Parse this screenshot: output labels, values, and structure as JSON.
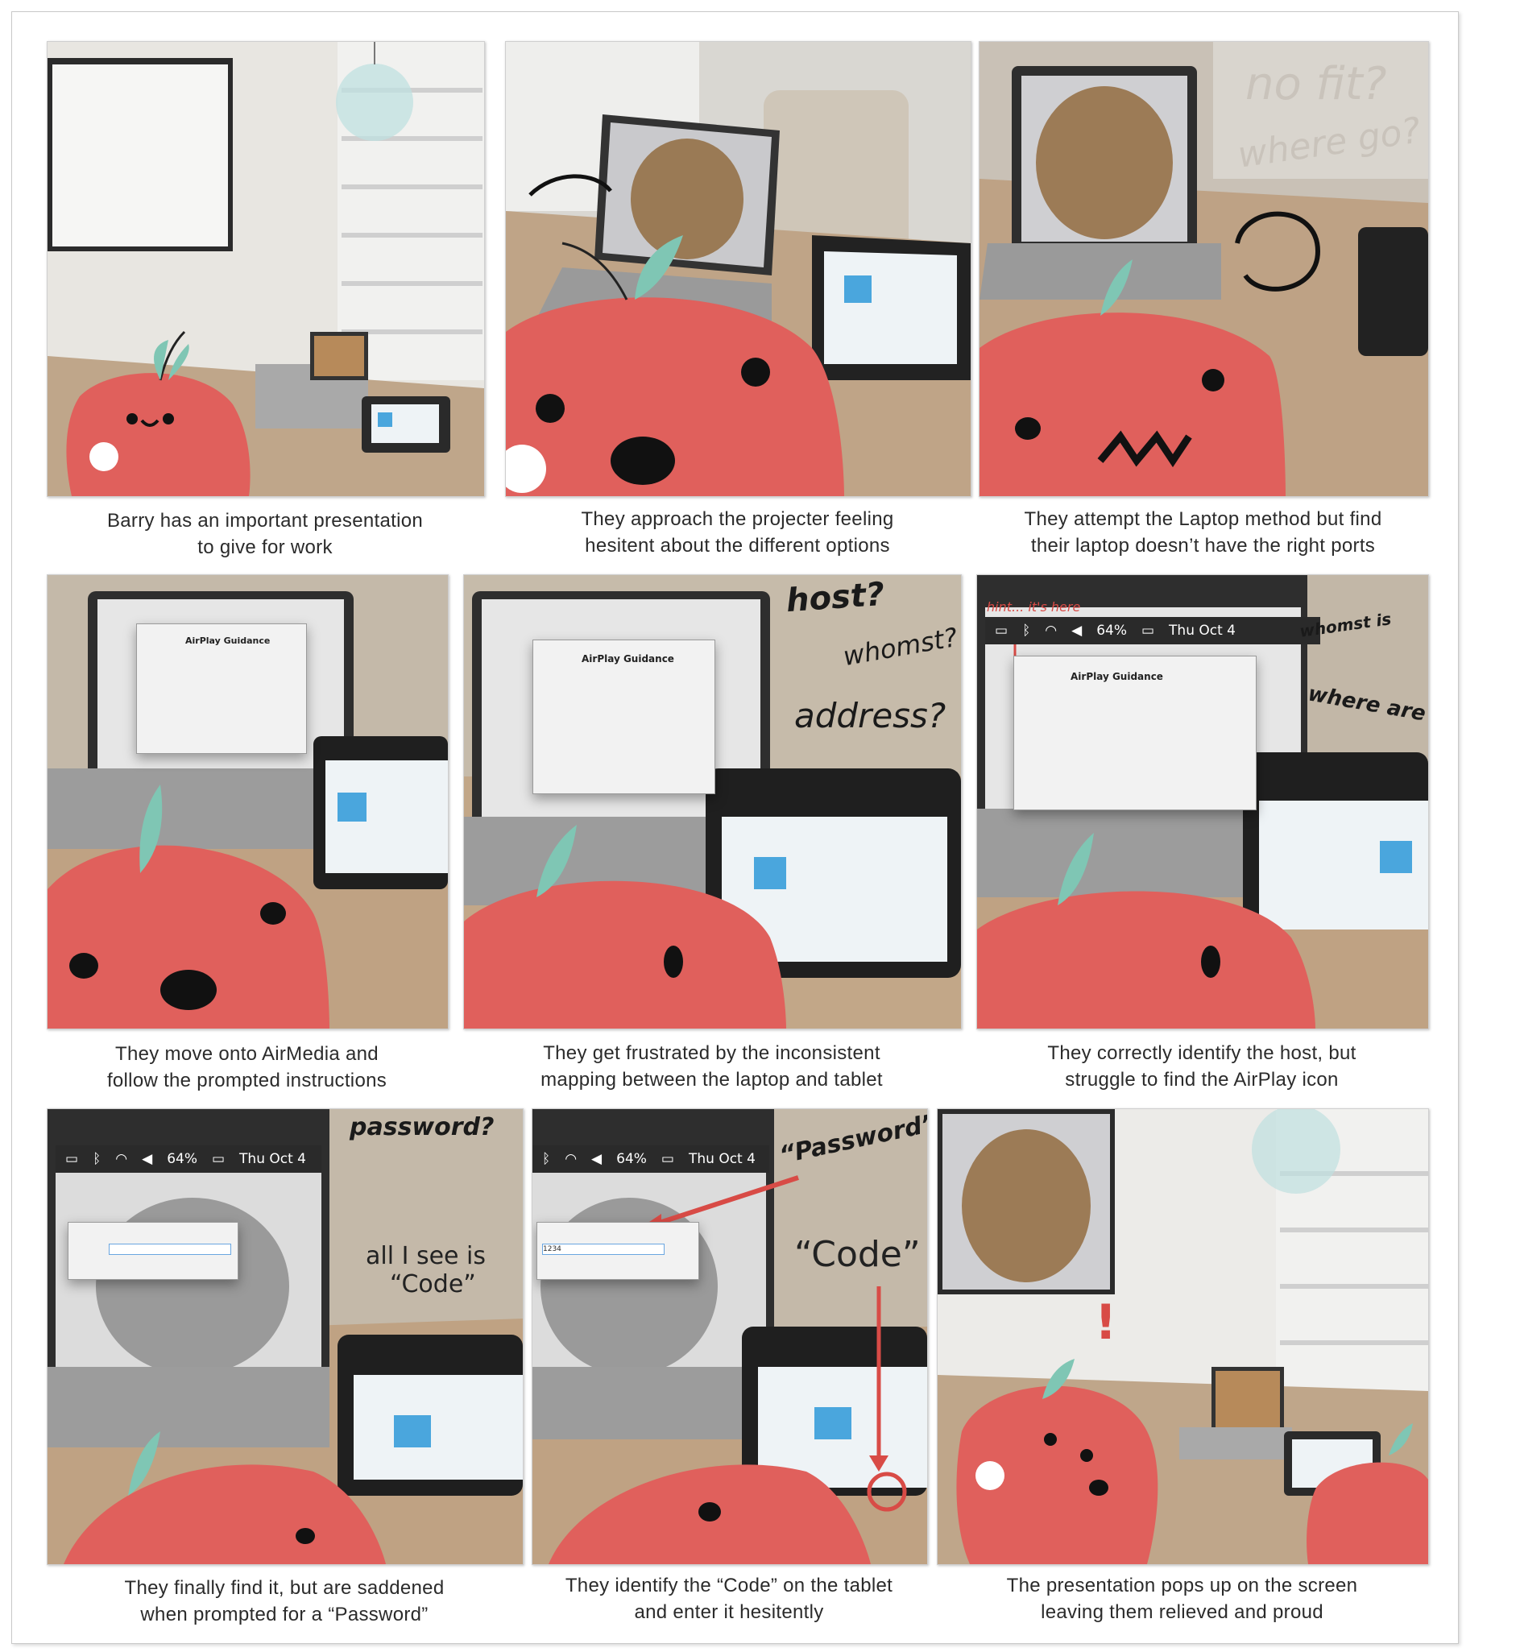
{
  "colors": {
    "apple": "#e0605c",
    "leaf": "#7fc6b4",
    "accent_red": "#d84b46",
    "tablet_blue": "#4aa6dd"
  },
  "panels": [
    {
      "caption_line1": "Barry has an important presentation",
      "caption_line2": "to give for work"
    },
    {
      "caption_line1": "They approach the projecter feeling",
      "caption_line2": "hesitent about the different options"
    },
    {
      "caption_line1": "They attempt the Laptop method but find",
      "caption_line2": "their laptop doesn’t have the right ports",
      "overlay_1": "no fit?",
      "overlay_2": "where go?"
    },
    {
      "caption_line1": "They move onto AirMedia and",
      "caption_line2": "follow the prompted instructions",
      "dialog_title": "AirPlay Guidance"
    },
    {
      "caption_line1": "They get frustrated by the inconsistent",
      "caption_line2": "mapping between the laptop and tablet",
      "overlay_1": "host?",
      "overlay_2": "whomst?",
      "overlay_3": "address?",
      "dialog_title": "AirPlay Guidance"
    },
    {
      "caption_line1": "They correctly identify the host, but",
      "caption_line2": "struggle to find the AirPlay icon",
      "hint": "hint... it's here",
      "battery": "64%",
      "date": "Thu Oct 4",
      "overlay_1": "whomst is",
      "overlay_2": "where are",
      "dialog_title": "AirPlay Guidance"
    },
    {
      "caption_line1": "They finally find it, but are saddened",
      "caption_line2": "when prompted for a “Password”",
      "battery": "64%",
      "date": "Thu Oct 4",
      "overlay_1": "password?",
      "overlay_2": "all I see is",
      "overlay_3": "“Code”"
    },
    {
      "caption_line1": "They identify the “Code” on the tablet",
      "caption_line2": "and enter it hesitently",
      "battery": "64%",
      "date": "Thu Oct 4",
      "overlay_1": "“Password”",
      "overlay_2": "“Code”",
      "entered_code": "1234"
    },
    {
      "caption_line1": "The presentation pops up on the screen",
      "caption_line2": "leaving them relieved and proud",
      "exclaim": "!"
    }
  ]
}
